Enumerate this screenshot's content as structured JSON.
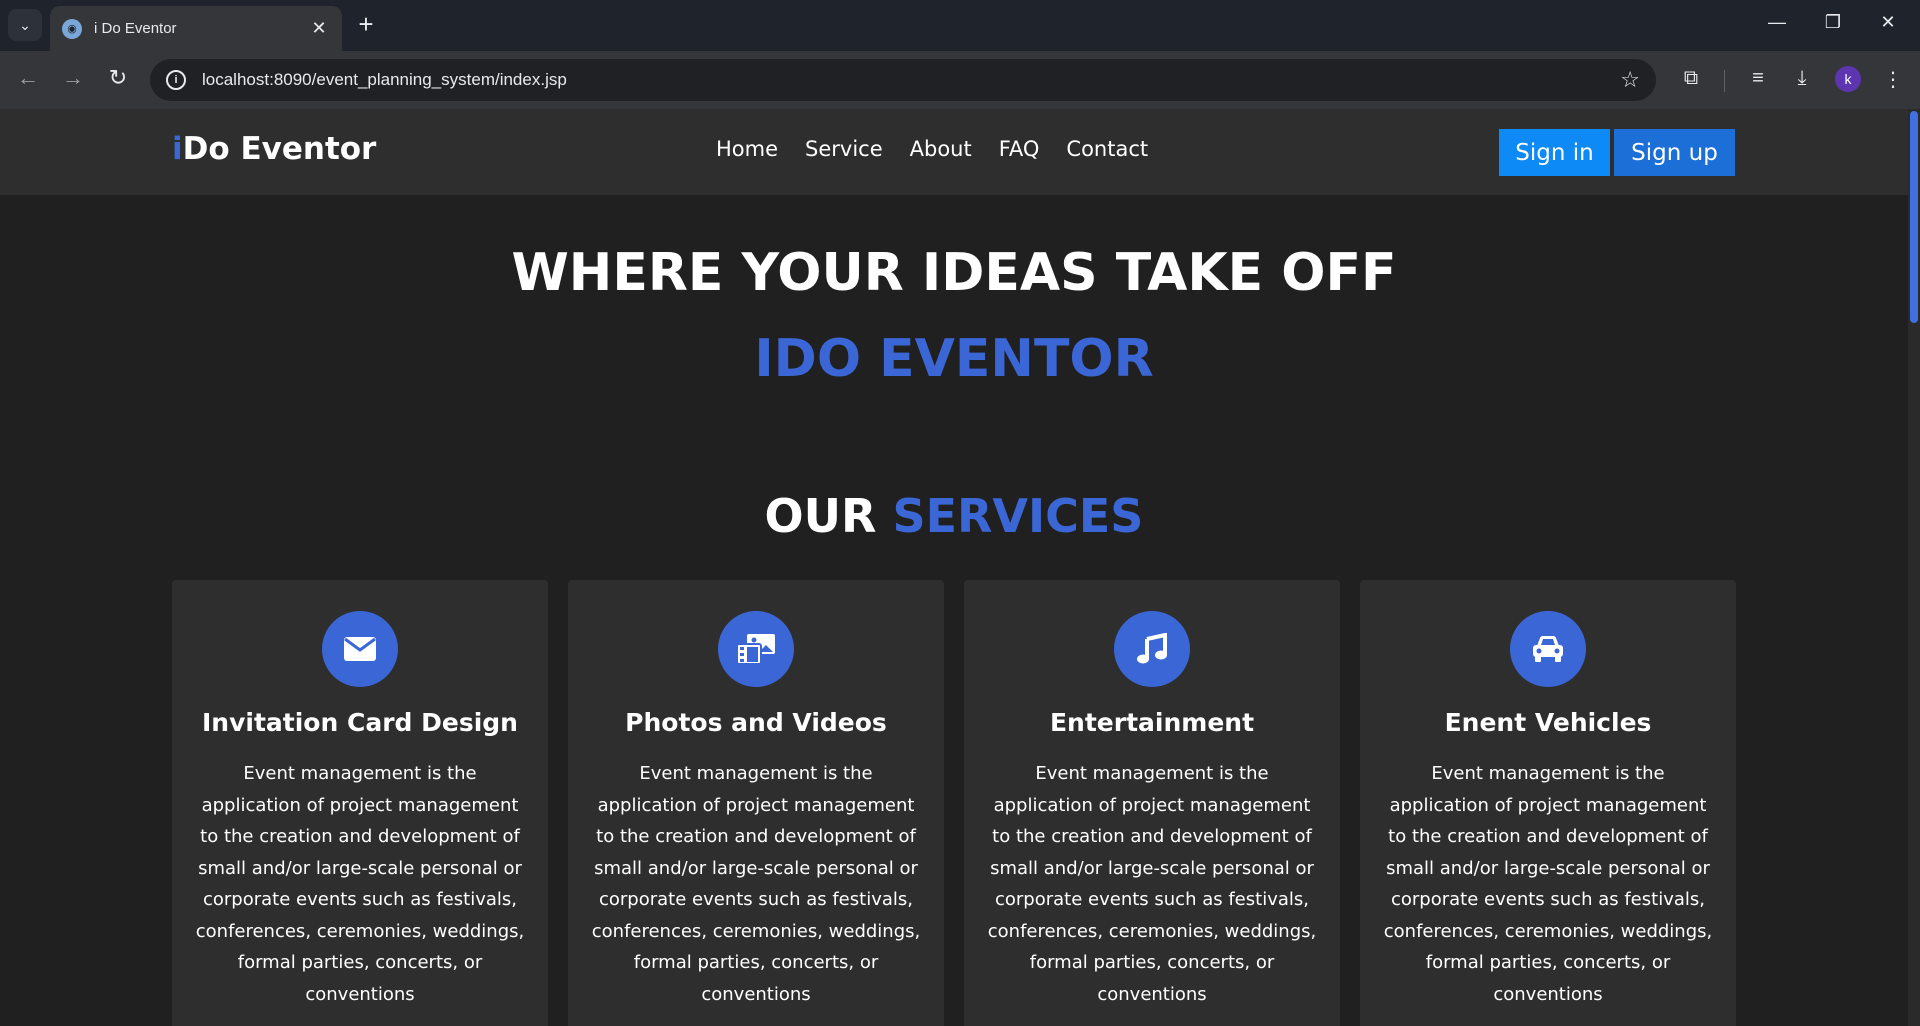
{
  "browser": {
    "tab_title": "i Do Eventor",
    "url": "localhost:8090/event_planning_system/index.jsp",
    "profile_initial": "k"
  },
  "navbar": {
    "logo_i": "i",
    "logo_rest": "Do Eventor",
    "links": [
      "Home",
      "Service",
      "About",
      "FAQ",
      "Contact"
    ],
    "signin_label": "Sign in",
    "signup_label": "Sign up"
  },
  "hero": {
    "title": "WHERE YOUR IDEAS TAKE OFF",
    "subtitle": "IDO EVENTOR"
  },
  "services": {
    "title_part1": "OUR ",
    "title_part2": "SERVICES",
    "cards": [
      {
        "icon": "envelope-icon",
        "title": "Invitation Card Design",
        "description": "Event management is the application of project management to the creation and development of small and/or large-scale personal or corporate events such as festivals, conferences, ceremonies, weddings, formal parties, concerts, or conventions"
      },
      {
        "icon": "photo-video-icon",
        "title": "Photos and Videos",
        "description": "Event management is the application of project management to the creation and development of small and/or large-scale personal or corporate events such as festivals, conferences, ceremonies, weddings, formal parties, concerts, or conventions"
      },
      {
        "icon": "music-note-icon",
        "title": "Entertainment",
        "description": "Event management is the application of project management to the creation and development of small and/or large-scale personal or corporate events such as festivals, conferences, ceremonies, weddings, formal parties, concerts, or conventions"
      },
      {
        "icon": "car-icon",
        "title": "Enent Vehicles",
        "description": "Event management is the application of project management to the creation and development of small and/or large-scale personal or corporate events such as festivals, conferences, ceremonies, weddings, formal parties, concerts, or conventions"
      }
    ]
  },
  "colors": {
    "accent": "#3b67d6",
    "signin": "#0d8af5",
    "signup": "#1b6fd6",
    "page_bg": "#202020",
    "card_bg": "#2e2e2e"
  }
}
